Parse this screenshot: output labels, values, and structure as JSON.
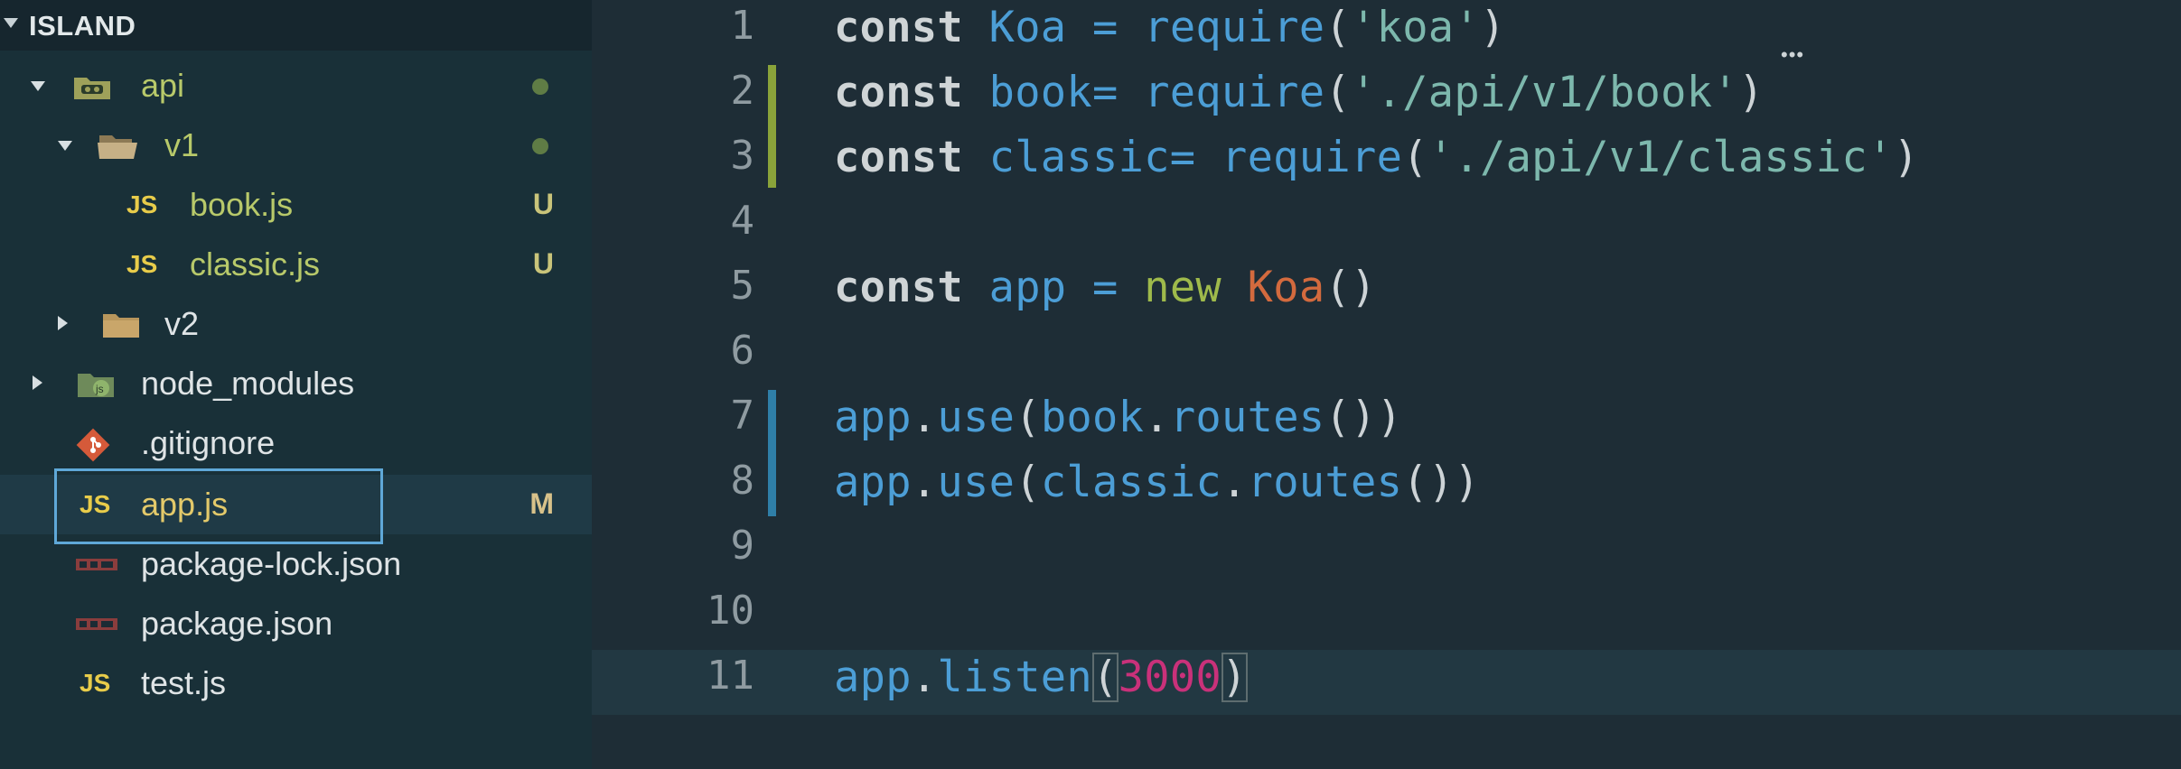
{
  "explorer": {
    "project_title": "ISLAND",
    "items": [
      {
        "label": "api",
        "status": ""
      },
      {
        "label": "v1",
        "status": ""
      },
      {
        "label": "book.js",
        "status": "U"
      },
      {
        "label": "classic.js",
        "status": "U"
      },
      {
        "label": "v2",
        "status": ""
      },
      {
        "label": "node_modules",
        "status": ""
      },
      {
        "label": ".gitignore",
        "status": ""
      },
      {
        "label": "app.js",
        "status": "M"
      },
      {
        "label": "package-lock.json",
        "status": ""
      },
      {
        "label": "package.json",
        "status": ""
      },
      {
        "label": "test.js",
        "status": ""
      }
    ],
    "js_icon_text": "JS"
  },
  "editor": {
    "line_numbers": [
      "1",
      "2",
      "3",
      "4",
      "5",
      "6",
      "7",
      "8",
      "9",
      "10",
      "11"
    ],
    "tokens": {
      "l1": [
        "const",
        "Koa",
        "=",
        "require",
        "(",
        "'koa'",
        ")"
      ],
      "l2": [
        "const",
        "book=",
        "require",
        "(",
        "'./api/v1/book'",
        ")"
      ],
      "l3": [
        "const",
        "classic=",
        "require",
        "(",
        "'./api/v1/classic'",
        ")"
      ],
      "l5": [
        "const",
        "app",
        "=",
        "new",
        "Koa",
        "()"
      ],
      "l7": [
        "app",
        ".",
        "use",
        "(",
        "book",
        ".",
        "routes",
        "())"
      ],
      "l8": [
        "app",
        ".",
        "use",
        "(",
        "classic",
        ".",
        "routes",
        "())"
      ],
      "l11": [
        "app",
        ".",
        "listen",
        "(",
        "3000",
        ")"
      ]
    }
  },
  "colors": {
    "sidebar_bg": "#193038",
    "editor_bg": "#1e2d36",
    "accent_blue": "#4c9ed6",
    "string_teal": "#7db8ad",
    "git_untracked": "#c9c47a",
    "js_yellow": "#e8cc4a",
    "selection_border": "#5fa8d8"
  }
}
